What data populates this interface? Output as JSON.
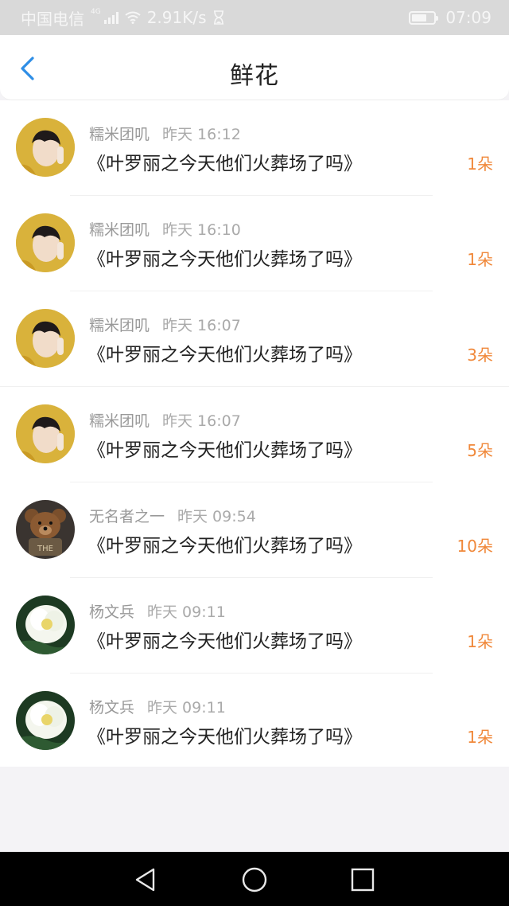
{
  "status_bar": {
    "carrier": "中国电信",
    "network": "4G",
    "speed": "2.91K/s",
    "time": "07:09"
  },
  "header": {
    "title": "鲜花",
    "back_icon": "chevron-left-icon"
  },
  "items": [
    {
      "name": "糯米团叽",
      "time": "昨天 16:12",
      "book": "《叶罗丽之今天他们火葬场了吗》",
      "count": "1朵",
      "avatar": "yellow-hood-avatar"
    },
    {
      "name": "糯米团叽",
      "time": "昨天 16:10",
      "book": "《叶罗丽之今天他们火葬场了吗》",
      "count": "1朵",
      "avatar": "yellow-hood-avatar"
    },
    {
      "name": "糯米团叽",
      "time": "昨天 16:07",
      "book": "《叶罗丽之今天他们火葬场了吗》",
      "count": "3朵",
      "avatar": "yellow-hood-avatar"
    },
    {
      "name": "糯米团叽",
      "time": "昨天 16:07",
      "book": "《叶罗丽之今天他们火葬场了吗》",
      "count": "5朵",
      "avatar": "yellow-hood-avatar"
    },
    {
      "name": "无名者之一",
      "time": "昨天 09:54",
      "book": "《叶罗丽之今天他们火葬场了吗》",
      "count": "10朵",
      "avatar": "teddy-bear-avatar"
    },
    {
      "name": "杨文兵",
      "time": "昨天 09:11",
      "book": "《叶罗丽之今天他们火葬场了吗》",
      "count": "1朵",
      "avatar": "white-flower-avatar"
    },
    {
      "name": "杨文兵",
      "time": "昨天 09:11",
      "book": "《叶罗丽之今天他们火葬场了吗》",
      "count": "1朵",
      "avatar": "white-flower-avatar"
    }
  ],
  "nav_bar": {
    "back": "triangle-back-icon",
    "home": "circle-home-icon",
    "recents": "square-recents-icon"
  },
  "colors": {
    "accent_blue": "#2e8ee6",
    "count_orange": "#f0883a",
    "status_bar_bg": "#d9d9d9"
  }
}
